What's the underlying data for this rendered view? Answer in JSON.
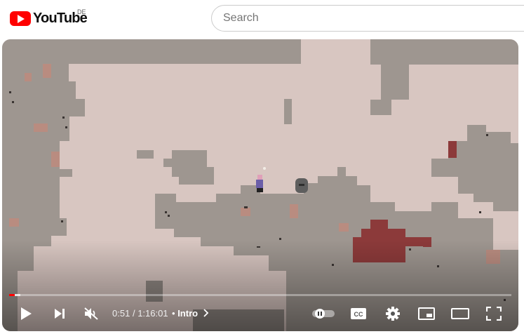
{
  "header": {
    "logo_text": "YouTube",
    "country_code": "DE",
    "search_placeholder": "Search"
  },
  "player": {
    "current_time": "0:51",
    "separator": "/",
    "duration": "1:16:01",
    "chapter_bullet": "•",
    "chapter": "Intro",
    "played_fraction": 0.011,
    "buffered_fraction": 0.022,
    "autoplay_on": true,
    "muted": true
  },
  "icons": {
    "play": "play-icon",
    "next": "next-icon",
    "mute": "volume-muted-icon",
    "chapter_arrow": "chevron-right-icon",
    "autoplay": "autoplay-toggle",
    "captions": "cc-icon",
    "settings": "gear-icon",
    "miniplayer": "miniplayer-icon",
    "theater": "theater-icon",
    "fullscreen": "fullscreen-icon"
  },
  "colors": {
    "brand_red": "#ff0000",
    "sky": "#d8c6c1",
    "rock": "#9e9690",
    "rock_dark": "#8f8782",
    "ore": "#b98c80",
    "blood": "#8c3a3a"
  }
}
